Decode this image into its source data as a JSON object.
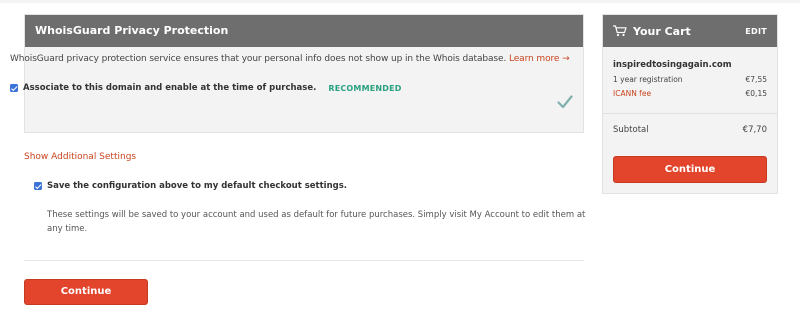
{
  "whoisguard": {
    "title": "WhoisGuard Privacy Protection",
    "description": "WhoisGuard privacy protection service ensures that your personal info does not show up in the Whois database.",
    "learn_more": "Learn more →",
    "option_label": "Associate to this domain and enable at the time of purchase.",
    "option_checked": true,
    "recommended": "RECOMMENDED"
  },
  "settings": {
    "show_additional": "Show Additional Settings",
    "save_label": "Save the configuration above to my default checkout settings.",
    "save_checked": true,
    "save_note": "These settings will be saved to your account and used as default for future purchases. Simply visit My Account to edit them at any time."
  },
  "main_continue": "Continue",
  "cart": {
    "title": "Your Cart",
    "edit": "EDIT",
    "domain": "inspiredtosingagain.com",
    "items": [
      {
        "name": "1 year registration",
        "price": "€7,55"
      },
      {
        "name": "ICANN fee",
        "price": "€0,15"
      }
    ],
    "subtotal_label": "Subtotal",
    "subtotal_value": "€7,70",
    "continue": "Continue"
  },
  "colors": {
    "header_bg": "#6e6e6e",
    "accent": "#e2452b",
    "link": "#c8441e",
    "recommended": "#2aa07e",
    "checkbox": "#3b73d9"
  },
  "icons": {
    "cart": "cart-icon",
    "check": "checkmark-icon"
  }
}
